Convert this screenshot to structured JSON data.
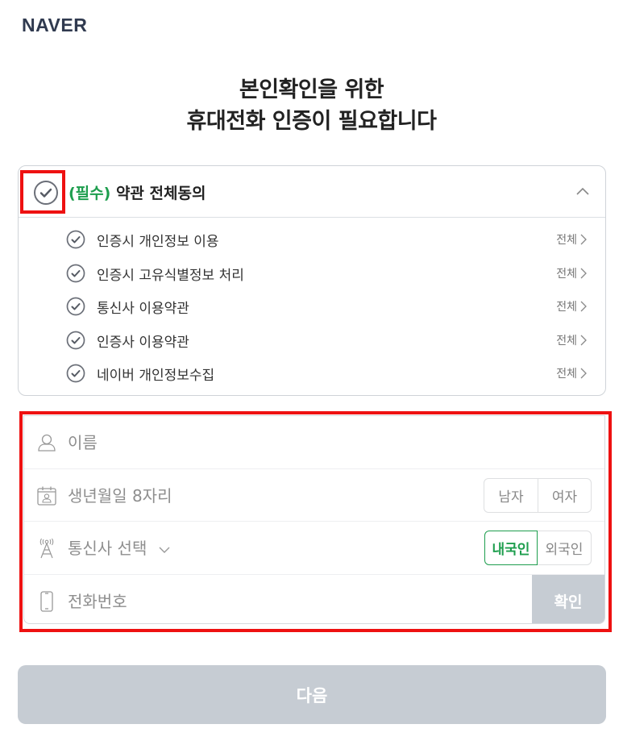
{
  "brand": {
    "logo": "NAVER",
    "accent_color": "#1e9e4e"
  },
  "header": {
    "title_line1": "본인확인을 위한",
    "title_line2": "휴대전화 인증이 필요합니다"
  },
  "terms": {
    "all": {
      "required_tag": "(필수)",
      "label": "약관 전체동의",
      "checked": false,
      "expanded": true
    },
    "items": [
      {
        "label": "인증시 개인정보 이용",
        "view": "전체"
      },
      {
        "label": "인증시 고유식별정보 처리",
        "view": "전체"
      },
      {
        "label": "통신사 이용약관",
        "view": "전체"
      },
      {
        "label": "인증사 이용약관",
        "view": "전체"
      },
      {
        "label": "네이버 개인정보수집",
        "view": "전체"
      }
    ]
  },
  "form": {
    "name": {
      "placeholder": "이름",
      "value": ""
    },
    "birth": {
      "placeholder": "생년월일 8자리",
      "value": ""
    },
    "gender": {
      "options": [
        "남자",
        "여자"
      ],
      "selected": null
    },
    "carrier": {
      "placeholder": "통신사 선택",
      "value": ""
    },
    "nationality": {
      "options": [
        "내국인",
        "외국인"
      ],
      "selected": "내국인"
    },
    "phone": {
      "placeholder": "전화번호",
      "value": ""
    },
    "confirm_label": "확인"
  },
  "footer": {
    "next_label": "다음",
    "disabled": true
  }
}
